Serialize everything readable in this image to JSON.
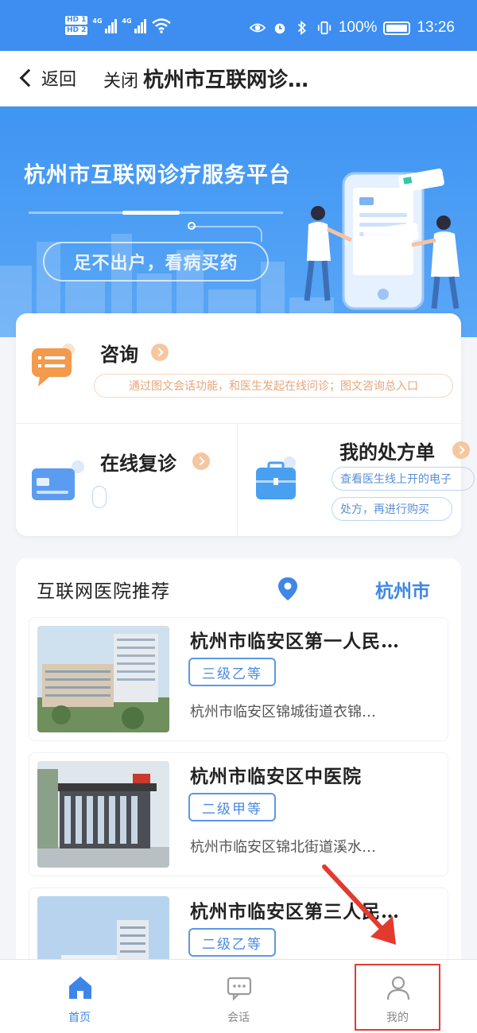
{
  "status_bar": {
    "hd1": "HD 1",
    "hd2": "HD 2",
    "net1": "4G",
    "net2": "4G",
    "battery": "100%",
    "time": "13:26"
  },
  "nav": {
    "back_label": "返回",
    "close_label": "关闭",
    "title": "杭州市互联网诊…"
  },
  "banner": {
    "title": "杭州市互联网诊疗服务平台",
    "slogan": "足不出户，看病买药"
  },
  "services": {
    "consult": {
      "title": "咨询",
      "desc": "通过图文会话功能，和医生发起在线问诊；图文咨询总入口"
    },
    "followup": {
      "title": "在线复诊"
    },
    "prescription": {
      "title": "我的处方单",
      "desc_line1": "查看医生线上开的电子",
      "desc_line2": "处方，再进行购买"
    }
  },
  "hospitals": {
    "heading": "互联网医院推荐",
    "city": "杭州市",
    "items": [
      {
        "name": "杭州市临安区第一人民…",
        "grade": "三级乙等",
        "address": "杭州市临安区锦城街道衣锦…"
      },
      {
        "name": "杭州市临安区中医院",
        "grade": "二级甲等",
        "address": "杭州市临安区锦北街道溪水…"
      },
      {
        "name": "杭州市临安区第三人民…",
        "grade": "二级乙等",
        "address": ""
      }
    ]
  },
  "tabbar": {
    "tabs": [
      {
        "label": "首页",
        "icon": "home-icon",
        "active": true
      },
      {
        "label": "会话",
        "icon": "chat-icon",
        "active": false
      },
      {
        "label": "我的",
        "icon": "user-icon",
        "active": false
      }
    ]
  },
  "colors": {
    "primary": "#3d8ef0",
    "accent_orange": "#f5c79f",
    "annotation_red": "#e23b2e"
  }
}
